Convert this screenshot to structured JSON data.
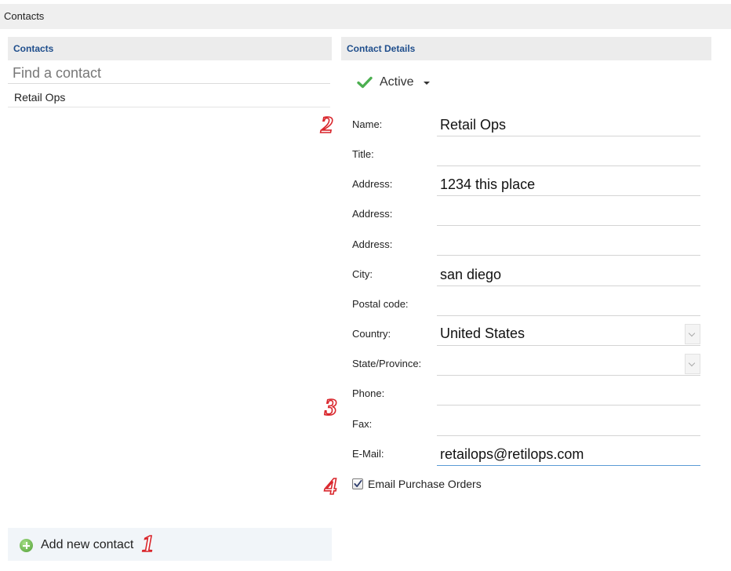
{
  "window": {
    "title": "Contacts"
  },
  "contacts_panel": {
    "header": "Contacts",
    "search_placeholder": "Find a contact",
    "items": [
      {
        "label": "Retail Ops"
      }
    ],
    "add_button_label": "Add new contact"
  },
  "details_panel": {
    "header": "Contact Details",
    "status": {
      "label": "Active",
      "icon": "checkmark-icon"
    },
    "fields": {
      "name": {
        "label": "Name:",
        "value": "Retail Ops"
      },
      "title": {
        "label": "Title:",
        "value": ""
      },
      "address1": {
        "label": "Address:",
        "value": "1234 this place"
      },
      "address2": {
        "label": "Address:",
        "value": ""
      },
      "address3": {
        "label": "Address:",
        "value": ""
      },
      "city": {
        "label": "City:",
        "value": "san diego"
      },
      "postal_code": {
        "label": "Postal code:",
        "value": ""
      },
      "country": {
        "label": "Country:",
        "value": "United States"
      },
      "state": {
        "label": "State/Province:",
        "value": ""
      },
      "phone": {
        "label": "Phone:",
        "value": ""
      },
      "fax": {
        "label": "Fax:",
        "value": ""
      },
      "email": {
        "label": "E-Mail:",
        "value": "retailops@retilops.com"
      }
    },
    "email_po": {
      "label": "Email Purchase Orders",
      "checked": true
    }
  },
  "annotations": {
    "one": "1",
    "two": "2",
    "three": "3",
    "four": "4"
  },
  "colors": {
    "header_text": "#1f4e8c",
    "callout": "#d9262c",
    "check_green": "#4caf50",
    "focus_underline": "#5b9bd5"
  }
}
